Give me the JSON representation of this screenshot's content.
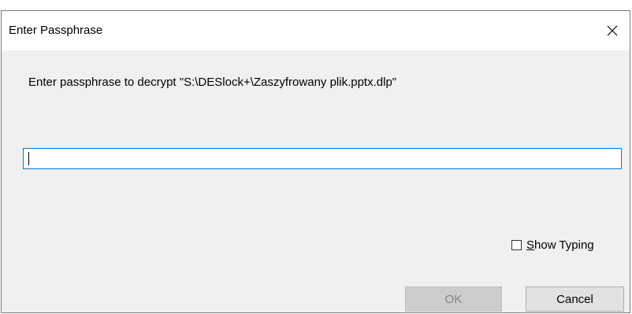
{
  "dialog": {
    "title": "Enter Passphrase",
    "close_icon": "close-icon",
    "prompt": "Enter passphrase to decrypt \"S:\\DESlock+\\Zaszyfrowany plik.pptx.dlp\"",
    "passphrase": {
      "value": "",
      "placeholder": ""
    },
    "show_typing": {
      "label_accel": "S",
      "label_rest": "how Typing",
      "checked": false
    },
    "buttons": {
      "ok_label": "OK",
      "cancel_label": "Cancel"
    }
  },
  "colors": {
    "dialog_bg": "#f0f0f0",
    "titlebar_bg": "#ffffff",
    "focus_border": "#0078d7",
    "disabled_button_bg": "#cccccc",
    "disabled_text": "#838383",
    "button_bg": "#e1e1e1"
  }
}
